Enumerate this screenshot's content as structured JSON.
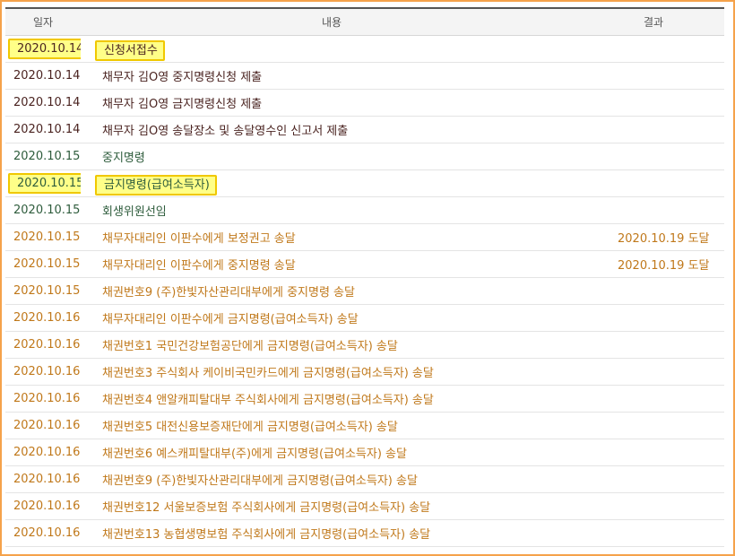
{
  "colors": {
    "frame_border": "#f5a24a",
    "highlight_fill": "#ffff88",
    "highlight_border": "#f0c800",
    "submission": "#4a2320",
    "court_decision": "#2e5c3c",
    "delivery": "#c0781a"
  },
  "header": {
    "date": "일자",
    "content": "내용",
    "result": "결과"
  },
  "rows": [
    {
      "date": "2020.10.14",
      "content": "신청서접수",
      "result": "",
      "kind": "submission",
      "highlight": true
    },
    {
      "date": "2020.10.14",
      "content": "채무자 김O영 중지명령신청 제출",
      "result": "",
      "kind": "submission",
      "highlight": false
    },
    {
      "date": "2020.10.14",
      "content": "채무자 김O영 금지명령신청 제출",
      "result": "",
      "kind": "submission",
      "highlight": false
    },
    {
      "date": "2020.10.14",
      "content": "채무자 김O영 송달장소 및 송달영수인 신고서 제출",
      "result": "",
      "kind": "submission",
      "highlight": false
    },
    {
      "date": "2020.10.15",
      "content": "중지명령",
      "result": "",
      "kind": "court_decision",
      "highlight": false
    },
    {
      "date": "2020.10.15",
      "content": "금지명령(급여소득자)",
      "result": "",
      "kind": "court_decision",
      "highlight": true
    },
    {
      "date": "2020.10.15",
      "content": "회생위원선임",
      "result": "",
      "kind": "court_decision",
      "highlight": false
    },
    {
      "date": "2020.10.15",
      "content": "채무자대리인 이판수에게 보정권고 송달",
      "result": "2020.10.19 도달",
      "kind": "delivery",
      "highlight": false
    },
    {
      "date": "2020.10.15",
      "content": "채무자대리인 이판수에게 중지명령 송달",
      "result": "2020.10.19 도달",
      "kind": "delivery",
      "highlight": false
    },
    {
      "date": "2020.10.15",
      "content": "채권번호9 (주)한빛자산관리대부에게 중지명령 송달",
      "result": "",
      "kind": "delivery",
      "highlight": false
    },
    {
      "date": "2020.10.16",
      "content": "채무자대리인 이판수에게 금지명령(급여소득자) 송달",
      "result": "",
      "kind": "delivery",
      "highlight": false
    },
    {
      "date": "2020.10.16",
      "content": "채권번호1 국민건강보험공단에게 금지명령(급여소득자) 송달",
      "result": "",
      "kind": "delivery",
      "highlight": false
    },
    {
      "date": "2020.10.16",
      "content": "채권번호3 주식회사 케이비국민카드에게 금지명령(급여소득자) 송달",
      "result": "",
      "kind": "delivery",
      "highlight": false
    },
    {
      "date": "2020.10.16",
      "content": "채권번호4 앤알캐피탈대부 주식회사에게 금지명령(급여소득자) 송달",
      "result": "",
      "kind": "delivery",
      "highlight": false
    },
    {
      "date": "2020.10.16",
      "content": "채권번호5 대전신용보증재단에게 금지명령(급여소득자) 송달",
      "result": "",
      "kind": "delivery",
      "highlight": false
    },
    {
      "date": "2020.10.16",
      "content": "채권번호6 예스캐피탈대부(주)에게 금지명령(급여소득자) 송달",
      "result": "",
      "kind": "delivery",
      "highlight": false
    },
    {
      "date": "2020.10.16",
      "content": "채권번호9 (주)한빛자산관리대부에게 금지명령(급여소득자) 송달",
      "result": "",
      "kind": "delivery",
      "highlight": false
    },
    {
      "date": "2020.10.16",
      "content": "채권번호12 서울보증보험 주식회사에게 금지명령(급여소득자) 송달",
      "result": "",
      "kind": "delivery",
      "highlight": false
    },
    {
      "date": "2020.10.16",
      "content": "채권번호13 농협생명보험 주식회사에게 금지명령(급여소득자) 송달",
      "result": "",
      "kind": "delivery",
      "highlight": false
    }
  ]
}
